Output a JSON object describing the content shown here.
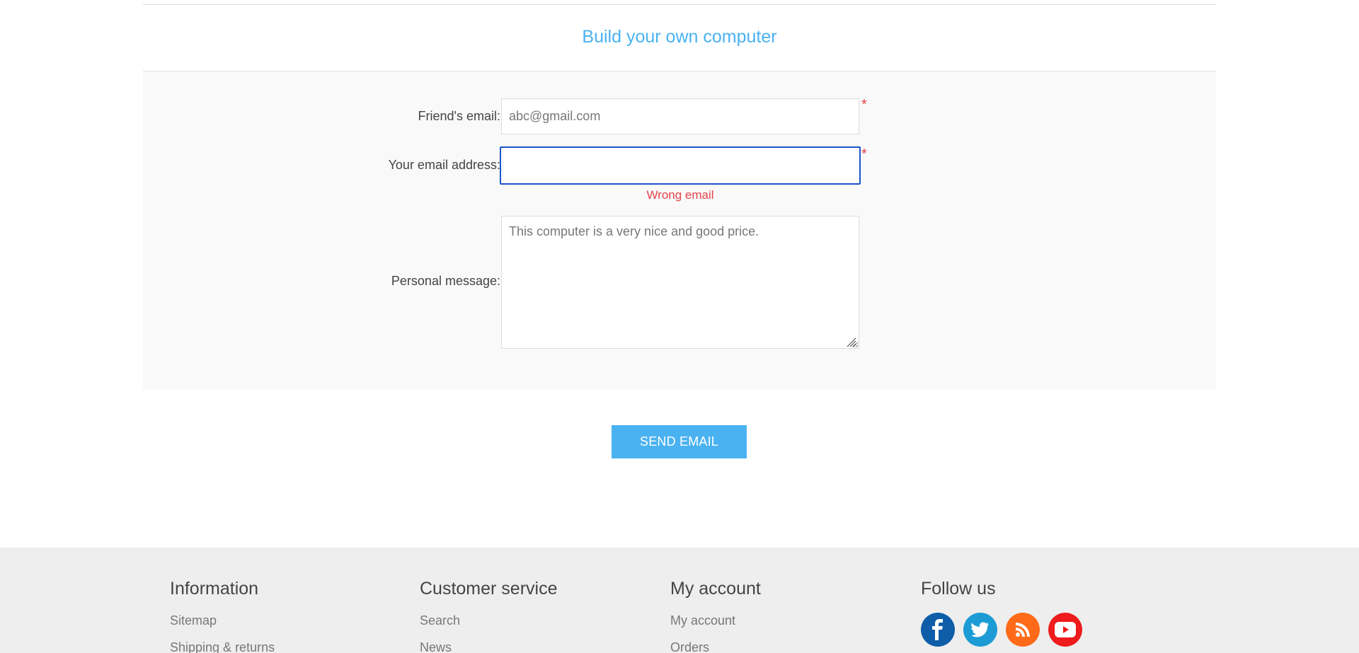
{
  "product": {
    "title": "Build your own computer"
  },
  "form": {
    "friend_email": {
      "label": "Friend's email:",
      "value": "abc@gmail.com",
      "required_mark": "*"
    },
    "your_email": {
      "label": "Your email address:",
      "value": "",
      "required_mark": "*",
      "error": "Wrong email"
    },
    "personal_message": {
      "label": "Personal message:",
      "value": "This computer is a very nice and good price."
    },
    "submit_label": "Send email"
  },
  "footer": {
    "information": {
      "title": "Information",
      "links": [
        "Sitemap",
        "Shipping & returns"
      ]
    },
    "customer_service": {
      "title": "Customer service",
      "links": [
        "Search",
        "News"
      ]
    },
    "my_account": {
      "title": "My account",
      "links": [
        "My account",
        "Orders"
      ]
    },
    "follow_us": {
      "title": "Follow us",
      "icons": [
        "facebook-icon",
        "twitter-icon",
        "rss-icon",
        "youtube-icon"
      ]
    }
  },
  "colors": {
    "accent": "#4ab2f1",
    "error": "#e4434b",
    "focus_border": "#1a56c8",
    "facebook": "#0e5da8",
    "twitter": "#1c9bd5",
    "rss": "#ff6a19",
    "youtube": "#ee1c1c"
  }
}
